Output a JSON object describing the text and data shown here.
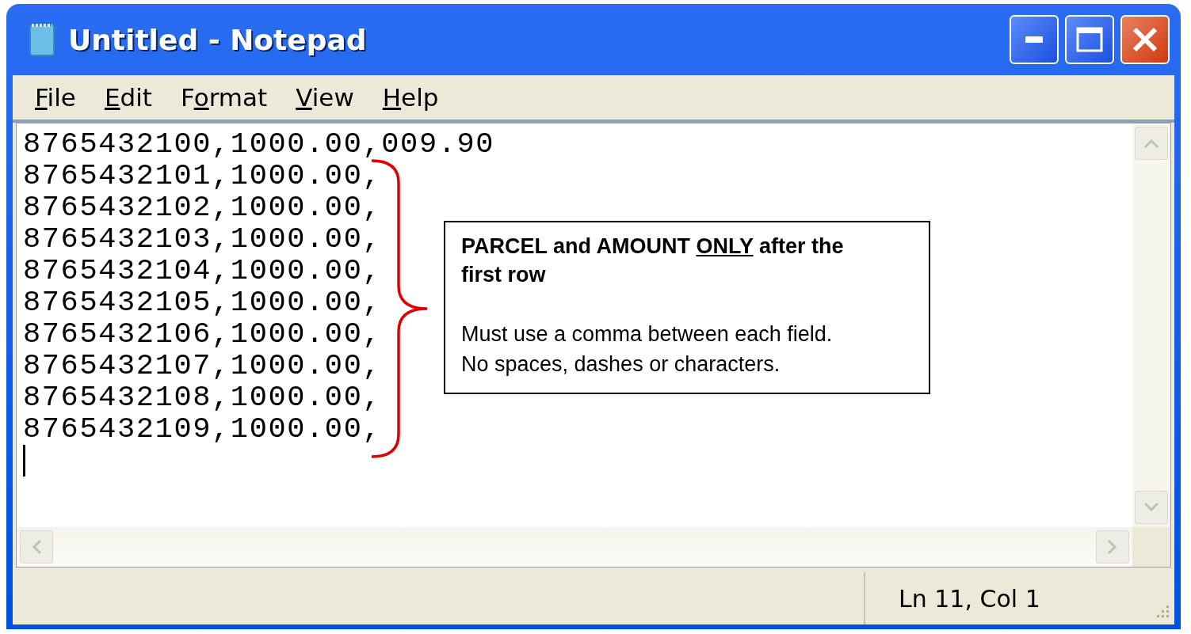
{
  "window": {
    "title": "Untitled - Notepad"
  },
  "menu": [
    {
      "label": [
        {
          "text": "F",
          "underline": true
        },
        {
          "text": "ile",
          "underline": false
        }
      ]
    },
    {
      "label": [
        {
          "text": "E",
          "underline": true
        },
        {
          "text": "dit",
          "underline": false
        }
      ]
    },
    {
      "label": [
        {
          "text": "F",
          "underline": false
        },
        {
          "text": "o",
          "underline": true
        },
        {
          "text": "rmat",
          "underline": false
        }
      ]
    },
    {
      "label": [
        {
          "text": "V",
          "underline": true
        },
        {
          "text": "iew",
          "underline": false
        }
      ]
    },
    {
      "label": [
        {
          "text": "H",
          "underline": true
        },
        {
          "text": "elp",
          "underline": false
        }
      ]
    }
  ],
  "editor": {
    "lines": [
      "8765432100,1000.00,009.90",
      "8765432101,1000.00,",
      "8765432102,1000.00,",
      "8765432103,1000.00,",
      "8765432104,1000.00,",
      "8765432105,1000.00,",
      "8765432106,1000.00,",
      "8765432107,1000.00,",
      "8765432108,1000.00,",
      "8765432109,1000.00,"
    ]
  },
  "callout": {
    "heading": [
      {
        "text": "PARCEL and AMOUNT ",
        "underline": false
      },
      {
        "text": "ONLY",
        "underline": true
      },
      {
        "text": " after the first row",
        "underline": false
      }
    ],
    "body": [
      "Must use a comma between each field.",
      "No spaces, dashes or characters."
    ]
  },
  "status_bar": {
    "position": "Ln 11, Col 1"
  }
}
